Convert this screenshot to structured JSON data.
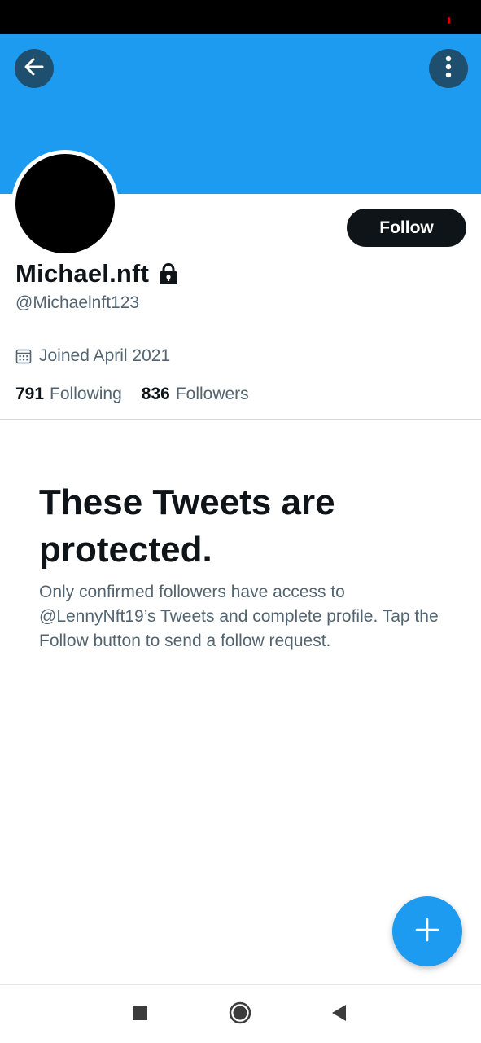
{
  "colors": {
    "banner": "#1d9bf0",
    "header_button_bg": "#1f4f6e",
    "fab": "#1d9bf0",
    "follow_button_bg": "#0f1419",
    "secondary_text": "#536471",
    "status_indicator": "#d60000"
  },
  "header": {
    "back_icon": "arrow-left-icon",
    "more_icon": "more-vertical-icon"
  },
  "profile": {
    "display_name": "Michael.nft",
    "protected_icon": "lock-icon",
    "handle": "@Michaelnft123",
    "joined_icon": "calendar-icon",
    "joined": "Joined April 2021",
    "following_count": "791",
    "following_label": "Following",
    "followers_count": "836",
    "followers_label": "Followers",
    "follow_button_label": "Follow"
  },
  "protected_notice": {
    "title": "These Tweets are protected.",
    "body": "Only confirmed followers have access to @LennyNft19’s Tweets and complete profile. Tap the Follow button to send a follow request."
  },
  "fab": {
    "icon": "plus-icon"
  },
  "navigation_bar": {
    "recents_icon": "square-icon",
    "home_icon": "circle-icon",
    "back_icon": "triangle-back-icon"
  }
}
